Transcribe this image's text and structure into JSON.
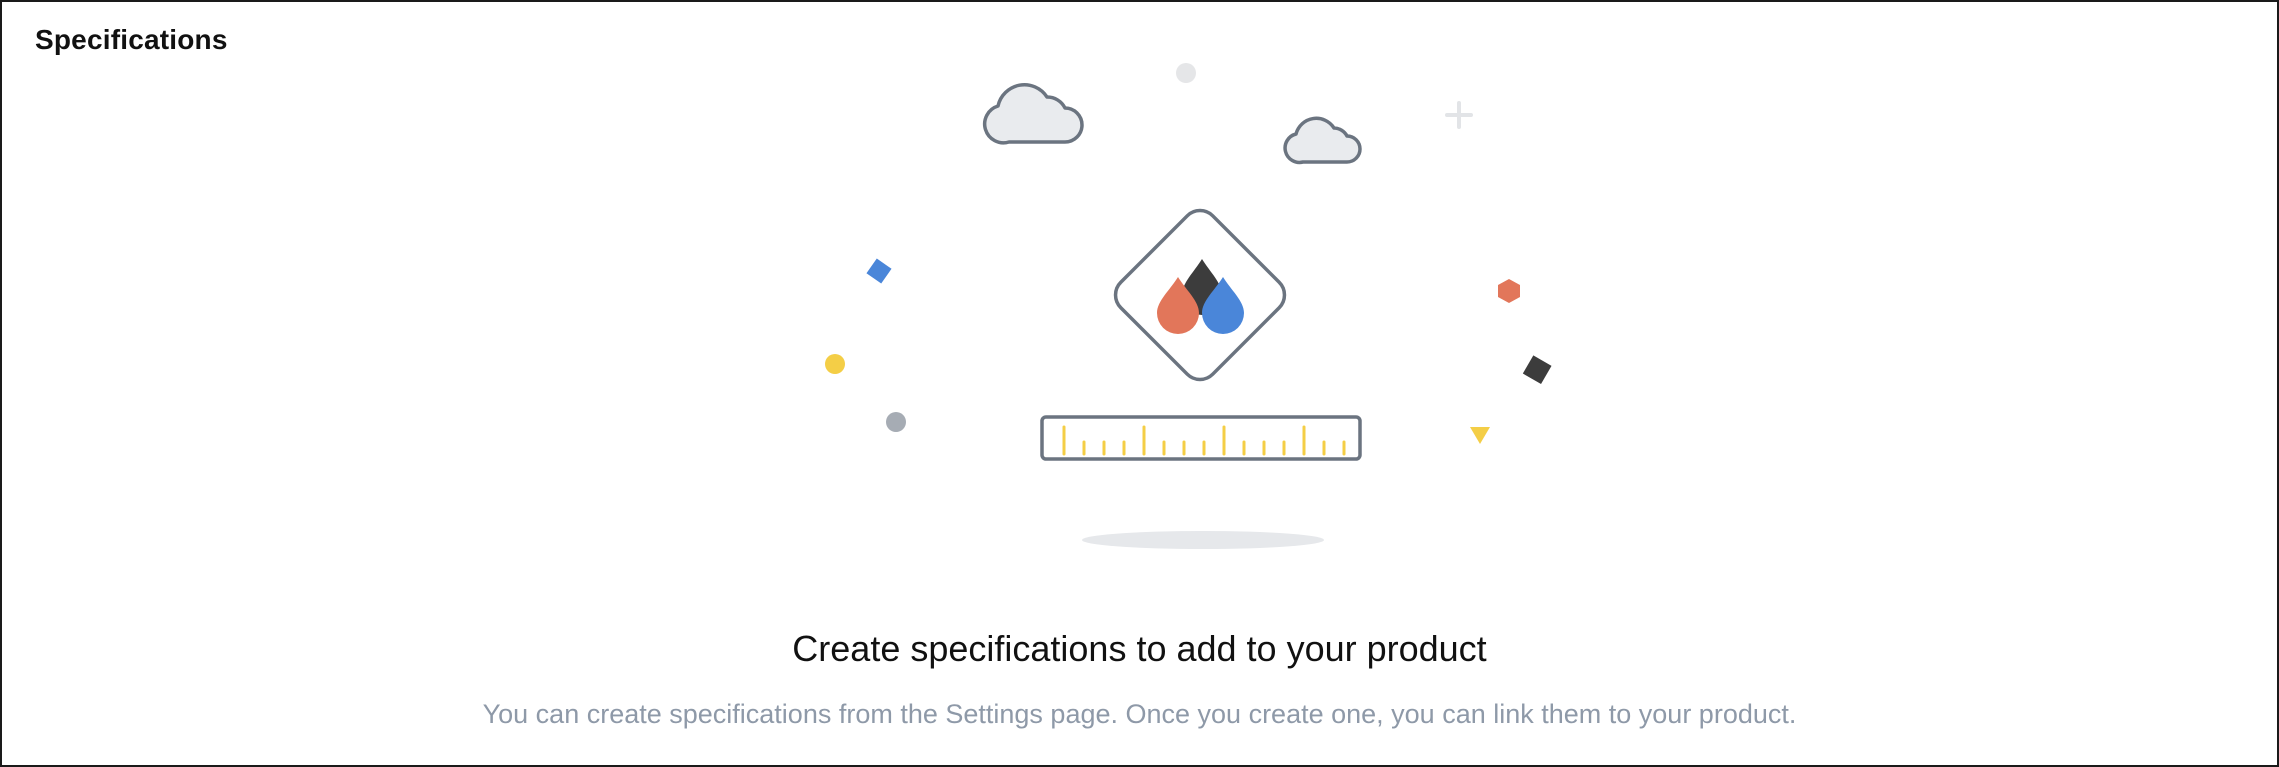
{
  "section": {
    "title": "Specifications"
  },
  "empty_state": {
    "heading": "Create specifications to add to your product",
    "description": "You can create specifications from the Settings page. Once you create one, you can link them to your product.",
    "illustration_icon": "specifications-empty-illustration"
  },
  "colors": {
    "outline": "#6b7480",
    "cloud_fill": "#e9ebee",
    "drop_orange": "#e2765a",
    "drop_blue": "#4a86d9",
    "drop_dark": "#3c3c3c",
    "ruler_ticks": "#f4ce46",
    "shadow": "#e6e8eb",
    "muted_text": "#8e99a8"
  }
}
